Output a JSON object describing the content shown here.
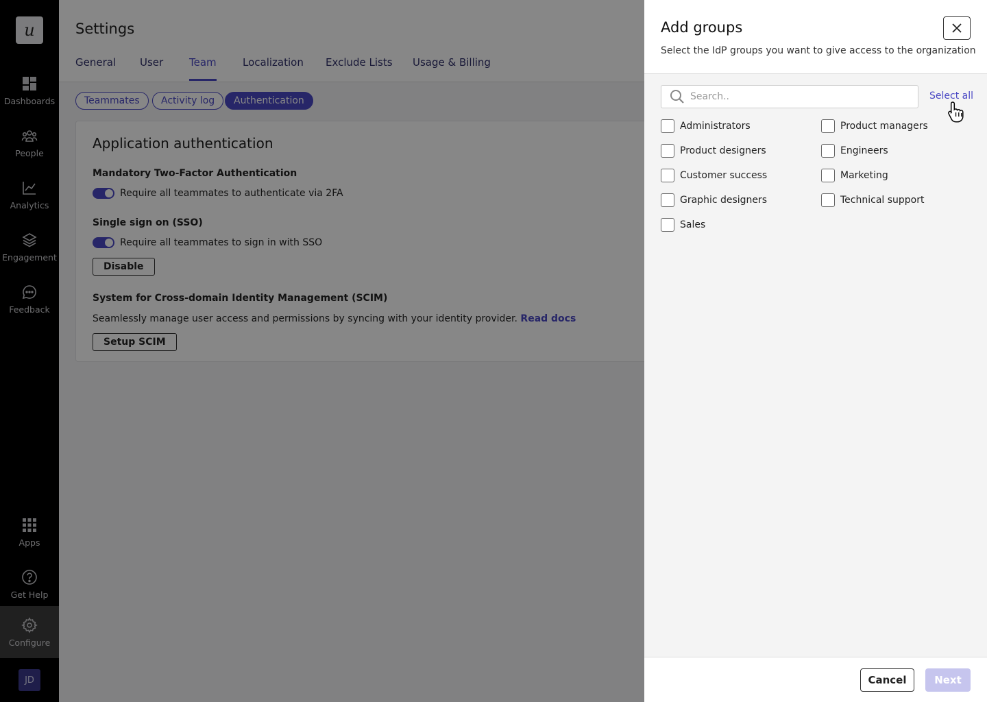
{
  "sidebar": {
    "logo": "u",
    "items": [
      {
        "label": "Dashboards",
        "icon": "dashboard-icon"
      },
      {
        "label": "People",
        "icon": "people-icon"
      },
      {
        "label": "Analytics",
        "icon": "analytics-icon"
      },
      {
        "label": "Engagement",
        "icon": "layers-icon"
      },
      {
        "label": "Feedback",
        "icon": "chat-icon"
      },
      {
        "label": "Apps",
        "icon": "grid-icon"
      },
      {
        "label": "Get Help",
        "icon": "help-icon"
      },
      {
        "label": "Configure",
        "icon": "gear-icon"
      }
    ],
    "avatar": "JD"
  },
  "header": {
    "title": "Settings",
    "tabs": [
      "General",
      "User",
      "Team",
      "Localization",
      "Exclude Lists",
      "Usage & Billing"
    ],
    "active_tab": "Team"
  },
  "subtabs": [
    "Teammates",
    "Activity log",
    "Authentication"
  ],
  "card": {
    "title": "Application authentication",
    "twofa": {
      "heading": "Mandatory Two-Factor Authentication",
      "toggle_label": "Require all teammates to authenticate via 2FA"
    },
    "sso": {
      "heading": "Single sign on (SSO)",
      "toggle_label": "Require all teammates to sign in with SSO",
      "button": "Disable"
    },
    "scim": {
      "heading": "System for Cross-domain Identity Management (SCIM)",
      "description": "Seamlessly manage user access and permissions by syncing with your identity provider.",
      "link": "Read docs",
      "button": "Setup SCIM"
    }
  },
  "drawer": {
    "title": "Add groups",
    "subtitle": "Select the IdP groups you want to give access to the organization",
    "search_placeholder": "Search..",
    "select_all": "Select all",
    "groups": [
      "Administrators",
      "Product managers",
      "Product designers",
      "Engineers",
      "Customer success",
      "Marketing",
      "Graphic designers",
      "Technical support",
      "Sales"
    ],
    "cancel": "Cancel",
    "next": "Next"
  },
  "colors": {
    "accent": "#4a48c4",
    "sidebar": "#000000",
    "next_disabled": "#c6c5ee"
  }
}
